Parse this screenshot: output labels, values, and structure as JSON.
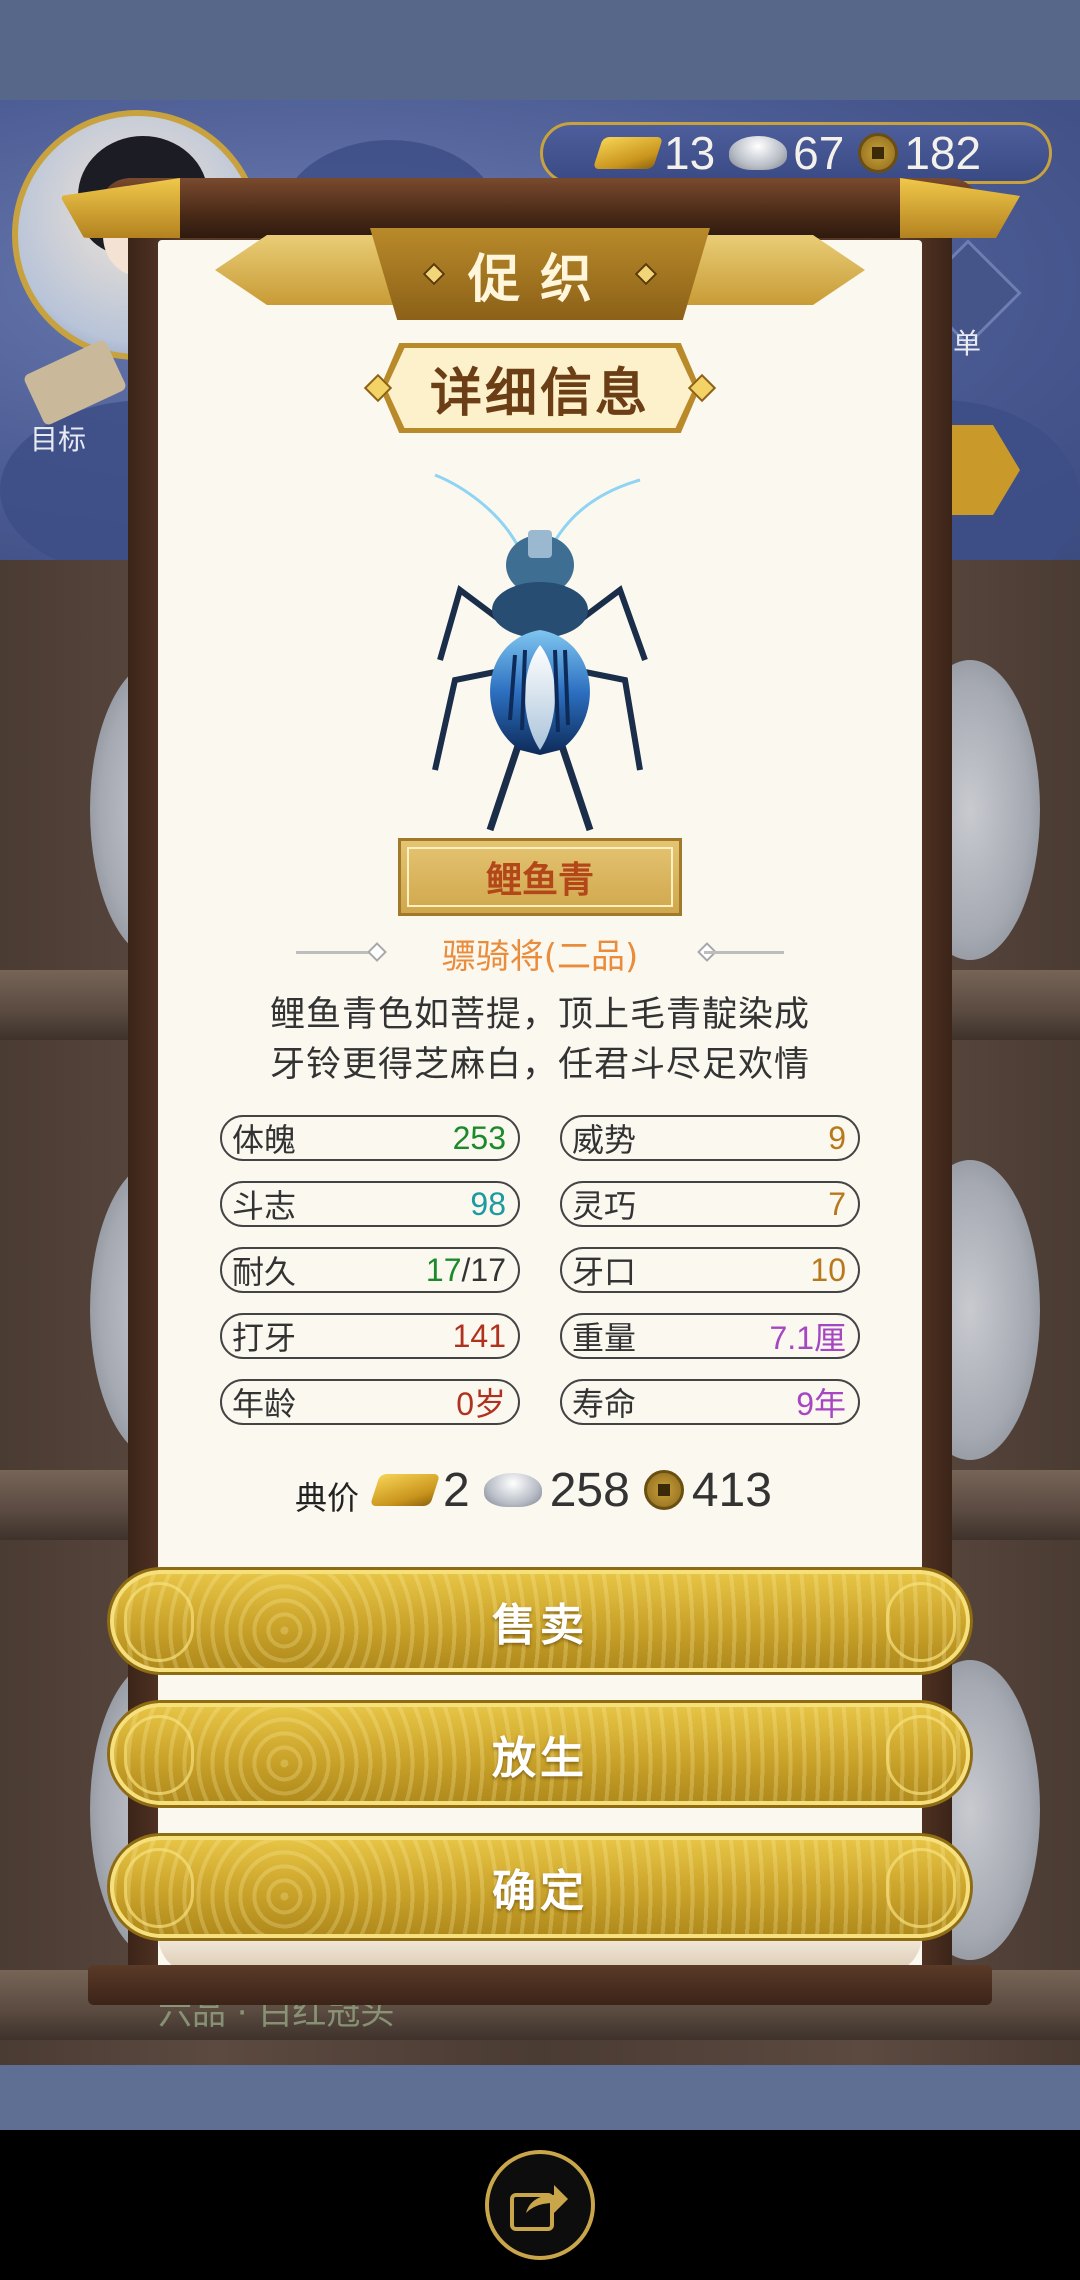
{
  "hud": {
    "gold": "13",
    "silver": "67",
    "coins": "182",
    "target_label": "目标",
    "menu_label": "菜单",
    "background_rank_text": "六品 · 白红冠头"
  },
  "modal": {
    "title": "促织",
    "subtitle": "详细信息"
  },
  "cricket": {
    "name": "鲤鱼青",
    "rank": "骠骑将(二品)",
    "poem_line1": "鲤鱼青色如菩提，顶上毛青靛染成",
    "poem_line2": "牙铃更得芝麻白，任君斗尽足欢情"
  },
  "stats": [
    {
      "label": "体魄",
      "value": "253",
      "color": "#1a8a2a"
    },
    {
      "label": "威势",
      "value": "9",
      "color": "#b8781c"
    },
    {
      "label": "斗志",
      "value": "98",
      "color": "#1b9aa0"
    },
    {
      "label": "灵巧",
      "value": "7",
      "color": "#b8781c"
    },
    {
      "label": "耐久",
      "value_green": "17",
      "value_rest": "/17",
      "color": "#1a8a2a"
    },
    {
      "label": "牙口",
      "value": "10",
      "color": "#b8781c"
    },
    {
      "label": "打牙",
      "value": "141",
      "color": "#b0321e"
    },
    {
      "label": "重量",
      "value": "7.1厘",
      "color": "#a646c2"
    },
    {
      "label": "年龄",
      "value": "0岁",
      "color": "#b0321e"
    },
    {
      "label": "寿命",
      "value": "9年",
      "color": "#a646c2"
    }
  ],
  "price": {
    "label": "典价",
    "gold": "2",
    "silver": "258",
    "coins": "413"
  },
  "buttons": {
    "sell": "售卖",
    "release": "放生",
    "confirm": "确定"
  },
  "colors": {
    "gold_accent": "#c8a23e",
    "paper": "#fbf8f0",
    "rank_orange": "#e98d3c",
    "name_red": "#b3471a"
  },
  "icons": [
    "gold-bar-icon",
    "silver-ingot-icon",
    "copper-coin-icon",
    "share-icon",
    "scroll-icon",
    "menu-icon",
    "back-arrow-icon"
  ]
}
